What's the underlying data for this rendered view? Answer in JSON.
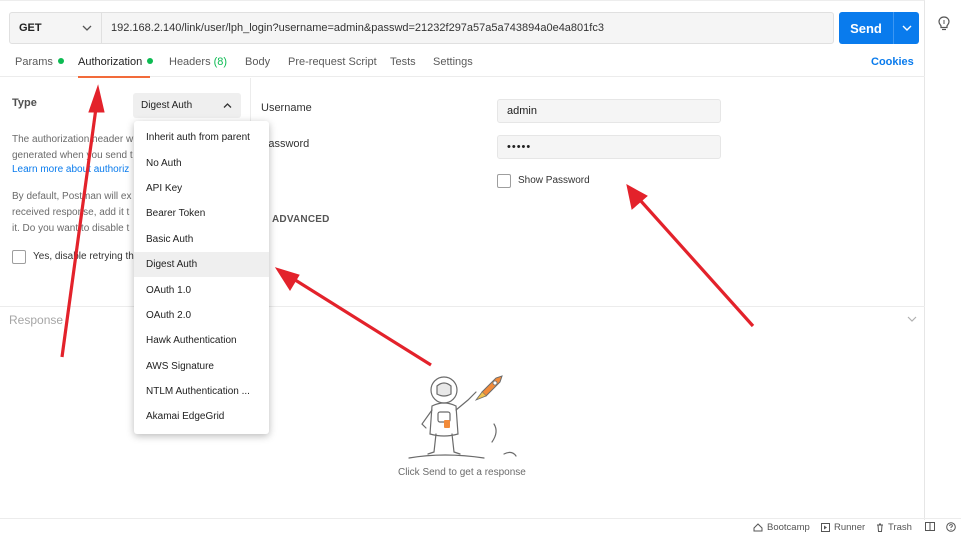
{
  "request": {
    "method": "GET",
    "url": "192.168.2.140/link/user/lph_login?username=admin&passwd=21232f297a57a5a743894a0e4a801fc3",
    "send_label": "Send"
  },
  "tabs": [
    {
      "label": "Params"
    },
    {
      "label": "Authorization"
    },
    {
      "label": "Headers",
      "count": "(8)"
    },
    {
      "label": "Body"
    },
    {
      "label": "Pre-request Script"
    },
    {
      "label": "Tests"
    },
    {
      "label": "Settings"
    }
  ],
  "cookies_label": "Cookies",
  "auth": {
    "type_label": "Type",
    "type_value": "Digest Auth",
    "desc_lines": [
      "The authorization header w",
      "generated when you send t",
      "Learn more about authoriz"
    ],
    "desc2_lines": [
      "By default, Postman will ex",
      "received response, add it t",
      "it. Do you want to disable t"
    ],
    "retry_label": "Yes, disable retrying th",
    "username_label": "Username",
    "username_value": "admin",
    "password_label": "Password",
    "password_value": "•••••",
    "show_password_label": "Show Password",
    "advanced_label": "ADVANCED"
  },
  "menu": {
    "items": [
      "Inherit auth from parent",
      "No Auth",
      "API Key",
      "Bearer Token",
      "Basic Auth",
      "Digest Auth",
      "OAuth 1.0",
      "OAuth 2.0",
      "Hawk Authentication",
      "AWS Signature",
      "NTLM Authentication ...",
      "Akamai EdgeGrid"
    ],
    "selected": "Digest Auth"
  },
  "response": {
    "label": "Response",
    "empty_message": "Click Send to get a response"
  },
  "statusbar": {
    "bootcamp": "Bootcamp",
    "runner": "Runner",
    "trash": "Trash"
  },
  "colors": {
    "accent": "#097bed",
    "tab_underline": "#f26b3a",
    "active_dot": "#0cbb52",
    "annotation_arrow": "#e3222b"
  }
}
